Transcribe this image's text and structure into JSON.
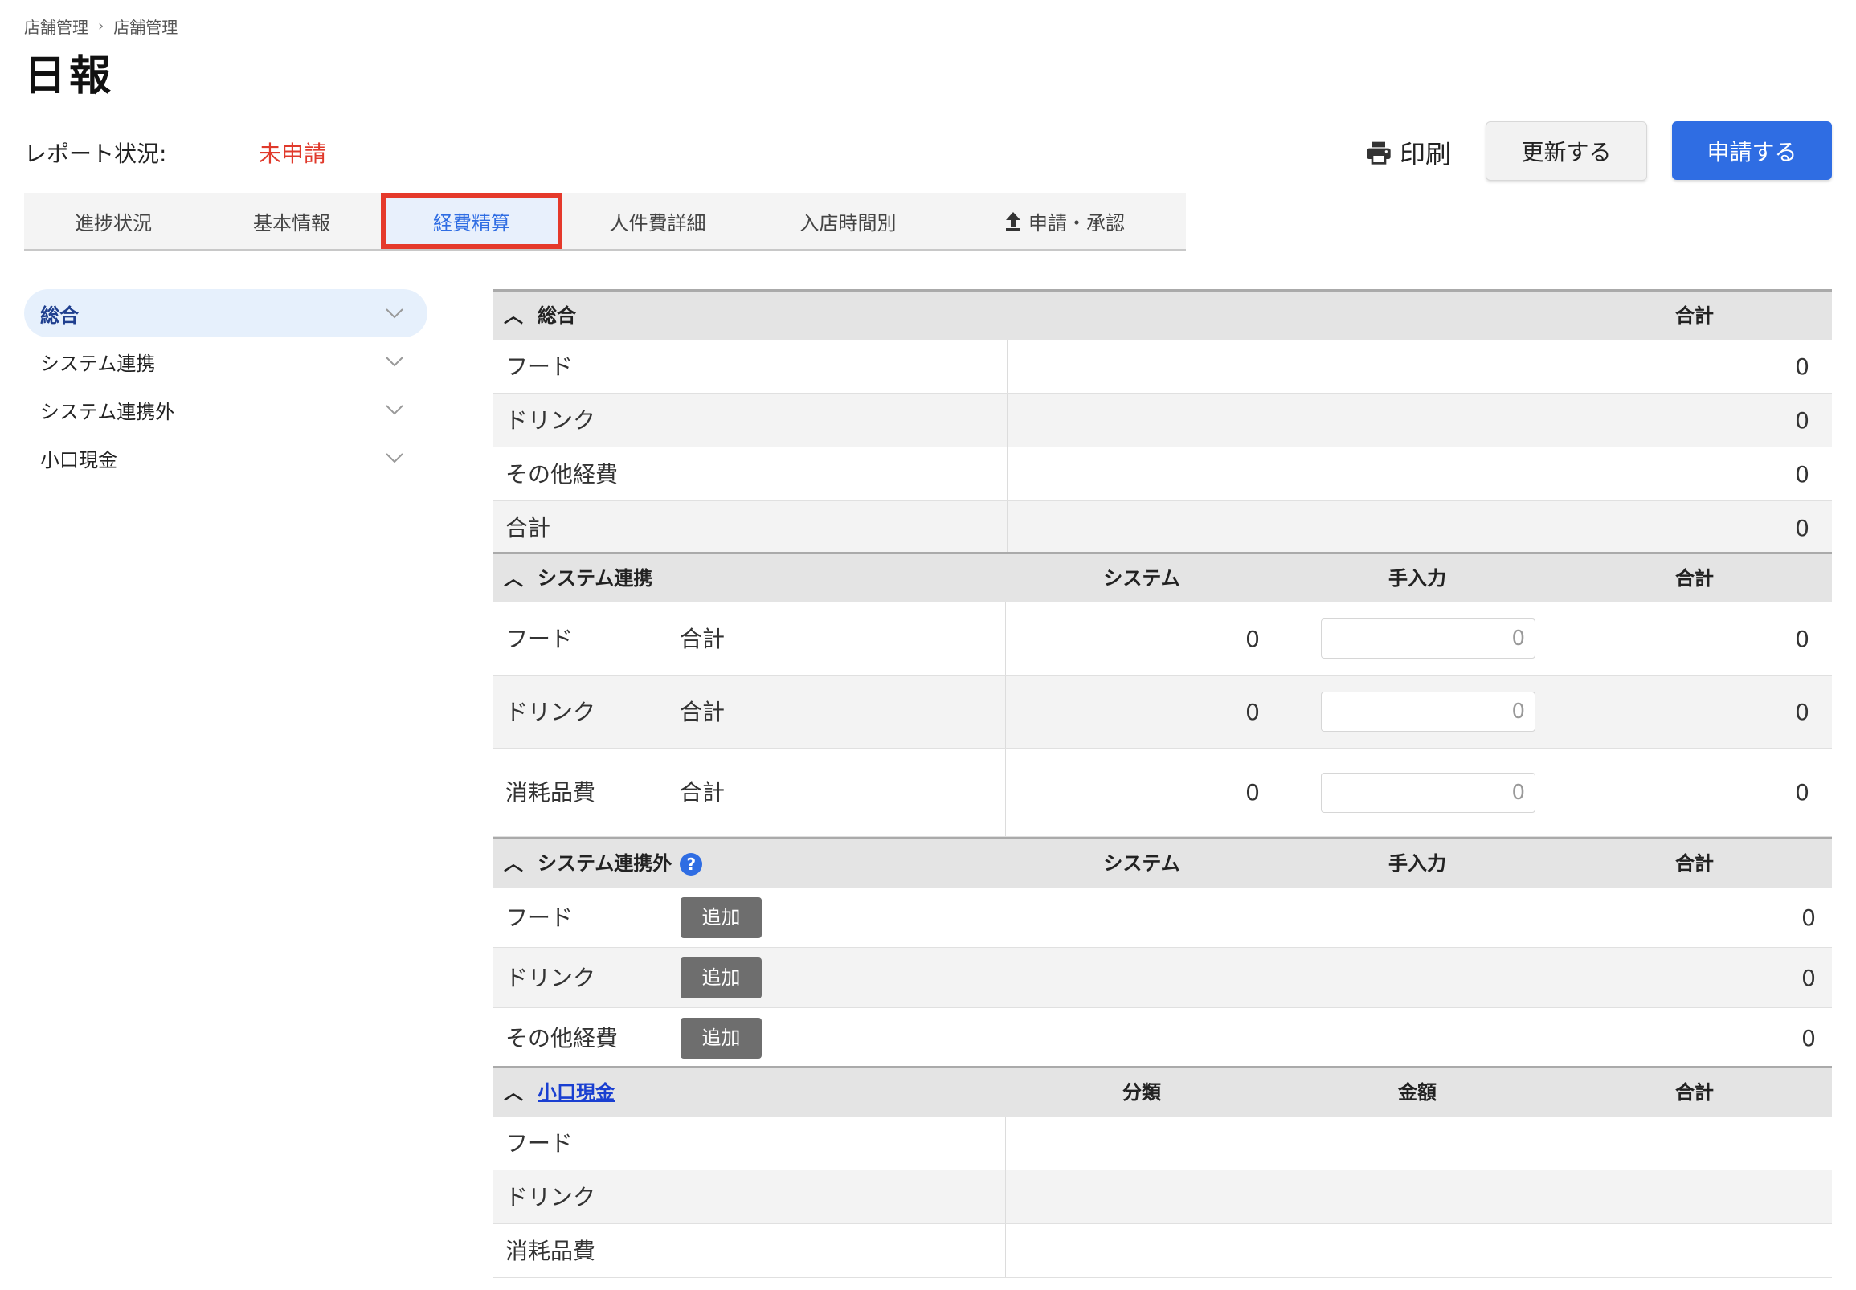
{
  "breadcrumb": [
    "店舗管理",
    "店舗管理"
  ],
  "page_title": "日報",
  "report_status": {
    "label": "レポート状況:",
    "value": "未申請"
  },
  "actions": {
    "print": "印刷",
    "update": "更新する",
    "submit": "申請する"
  },
  "tabs": [
    "進捗状況",
    "基本情報",
    "経費精算",
    "人件費詳細",
    "入店時間別",
    "申請・承認"
  ],
  "active_tab": "経費精算",
  "sidebar": [
    "総合",
    "システム連携",
    "システム連携外",
    "小口現金"
  ],
  "colors": {
    "primary": "#2f6de3",
    "alert": "#e0392b",
    "highlight": "#e5392b"
  },
  "sections": {
    "summary": {
      "title": "総合",
      "col_total": "合計",
      "rows": [
        {
          "label": "フード",
          "total": "0"
        },
        {
          "label": "ドリンク",
          "total": "0"
        },
        {
          "label": "その他経費",
          "total": "0"
        },
        {
          "label": "合計",
          "total": "0"
        }
      ]
    },
    "system": {
      "title": "システム連携",
      "col_system": "システム",
      "col_manual": "手入力",
      "col_total": "合計",
      "rows": [
        {
          "label": "フード",
          "sub": "合計",
          "system": "0",
          "manual": "0",
          "total": "0"
        },
        {
          "label": "ドリンク",
          "sub": "合計",
          "system": "0",
          "manual": "0",
          "total": "0"
        },
        {
          "label": "消耗品費",
          "sub": "合計",
          "system": "0",
          "manual": "0",
          "total": "0"
        }
      ]
    },
    "non_system": {
      "title": "システム連携外",
      "help": "?",
      "col_system": "システム",
      "col_manual": "手入力",
      "col_total": "合計",
      "add_label": "追加",
      "rows": [
        {
          "label": "フード",
          "total": "0"
        },
        {
          "label": "ドリンク",
          "total": "0"
        },
        {
          "label": "その他経費",
          "total": "0"
        }
      ]
    },
    "petty_cash": {
      "title": "小口現金",
      "col_category": "分類",
      "col_amount": "金額",
      "col_total": "合計",
      "rows": [
        {
          "label": "フード"
        },
        {
          "label": "ドリンク"
        },
        {
          "label": "消耗品費"
        }
      ]
    }
  }
}
